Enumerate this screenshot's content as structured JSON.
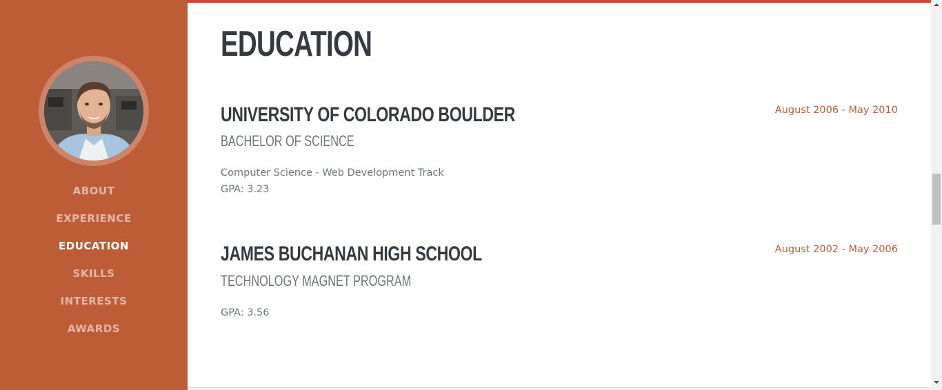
{
  "nav": {
    "items": [
      {
        "label": "ABOUT"
      },
      {
        "label": "EXPERIENCE"
      },
      {
        "label": "EDUCATION"
      },
      {
        "label": "SKILLS"
      },
      {
        "label": "INTERESTS"
      },
      {
        "label": "AWARDS"
      }
    ],
    "active": "EDUCATION"
  },
  "section": {
    "title": "EDUCATION"
  },
  "education": [
    {
      "school": "UNIVERSITY OF COLORADO BOULDER",
      "degree": "BACHELOR OF SCIENCE",
      "details": [
        "Computer Science - Web Development Track",
        "GPA: 3.23"
      ],
      "dates": "August 2006 - May 2010"
    },
    {
      "school": "JAMES BUCHANAN HIGH SCHOOL",
      "degree": "TECHNOLOGY MAGNET PROGRAM",
      "details": [
        "GPA: 3.56"
      ],
      "dates": "August 2002 - May 2006"
    }
  ],
  "colors": {
    "sidebar": "#bd5d38",
    "accent": "#bd5d38",
    "heading": "#343a40",
    "muted": "#6c757d"
  }
}
